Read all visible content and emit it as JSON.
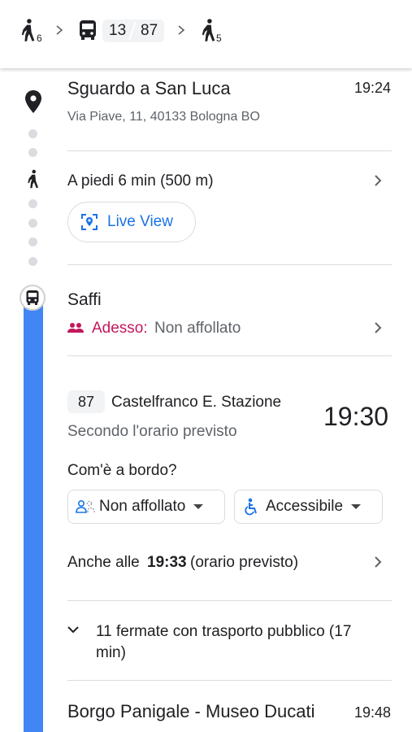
{
  "summary": {
    "walk_start_minutes": "6",
    "routes": [
      "13",
      "87"
    ],
    "walk_end_minutes": "5"
  },
  "origin": {
    "name": "Sguardo a San Luca",
    "address": "Via Piave, 11, 40133 Bologna BO",
    "time": "19:24"
  },
  "walk": {
    "label": "A piedi 6 min (500 m)",
    "live_view_label": "Live View"
  },
  "stop": {
    "name": "Saffi",
    "crowd_prefix": "Adesso:",
    "crowd_status": "Non affollato"
  },
  "transit": {
    "route": "87",
    "destination": "Castelfranco E. Stazione",
    "schedule_note": "Secondo l'orario previsto",
    "departure_time": "19:30",
    "onboard_question": "Com'è a bordo?",
    "crowd_dropdown": "Non affollato",
    "access_dropdown": "Accessibile",
    "also_prefix": "Anche alle",
    "also_time": "19:33",
    "also_suffix": "(orario previsto)",
    "stops_line1": "11 fermate con trasporto pubblico (17",
    "stops_line2": "min)"
  },
  "next_stop": {
    "name": "Borgo Panigale - Museo Ducati",
    "time": "19:48"
  },
  "colors": {
    "accent_blue": "#1a73e8",
    "timeline_blue": "#4285f4",
    "crowd_magenta": "#c2185b"
  }
}
